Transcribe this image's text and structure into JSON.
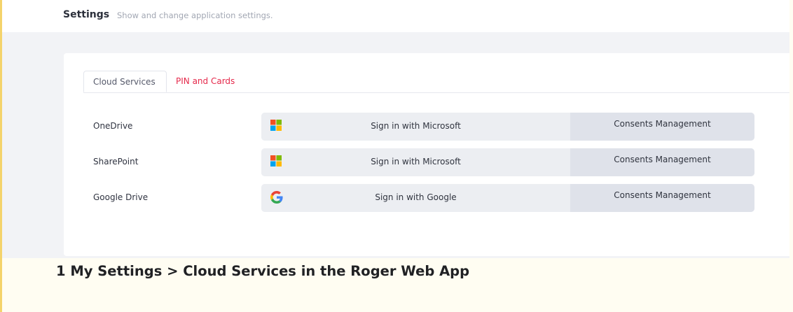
{
  "header": {
    "title": "Settings",
    "subtitle": "Show and change application settings."
  },
  "tabs": [
    {
      "label": "Cloud Services",
      "active": true
    },
    {
      "label": "PIN and Cards",
      "active": false
    }
  ],
  "services": [
    {
      "name": "OneDrive",
      "signin_label": "Sign in with Microsoft",
      "icon": "microsoft-logo-icon",
      "consent_label": "Consents Management"
    },
    {
      "name": "SharePoint",
      "signin_label": "Sign in with Microsoft",
      "icon": "microsoft-logo-icon",
      "consent_label": "Consents Management"
    },
    {
      "name": "Google Drive",
      "signin_label": "Sign in with Google",
      "icon": "google-logo-icon",
      "consent_label": "Consents Management"
    }
  ],
  "caption": "1 My Settings > Cloud Services in the Roger Web App",
  "colors": {
    "accent_red": "#e5294b",
    "ms_red": "#f25022",
    "ms_green": "#7fba00",
    "ms_blue": "#00a4ef",
    "ms_yellow": "#ffb900",
    "google_blue": "#4285f4",
    "google_red": "#ea4335",
    "google_yellow": "#fbbc05",
    "google_green": "#34a853"
  }
}
